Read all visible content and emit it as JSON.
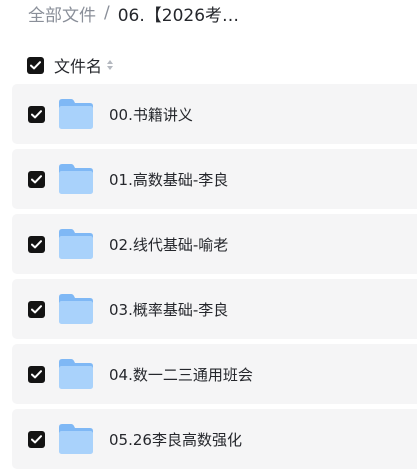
{
  "breadcrumb": {
    "root": "全部文件",
    "separator": "/",
    "current": "06.【2026考…"
  },
  "list_header": {
    "name_column": "文件名",
    "select_all_checked": true,
    "sort_icon": "sort-icon"
  },
  "files": [
    {
      "name": "00.书籍讲义",
      "type": "folder",
      "checked": true
    },
    {
      "name": "01.高数基础-李良",
      "type": "folder",
      "checked": true
    },
    {
      "name": "02.线代基础-喻老",
      "type": "folder",
      "checked": true
    },
    {
      "name": "03.概率基础-李良",
      "type": "folder",
      "checked": true
    },
    {
      "name": "04.数一二三通用班会",
      "type": "folder",
      "checked": true
    },
    {
      "name": "05.26李良高数强化",
      "type": "folder",
      "checked": true
    }
  ],
  "colors": {
    "row_background": "#f5f5f6",
    "checkbox": "#141414",
    "folder_light": "#a9d2fb",
    "folder_dark": "#7fb8f5"
  }
}
